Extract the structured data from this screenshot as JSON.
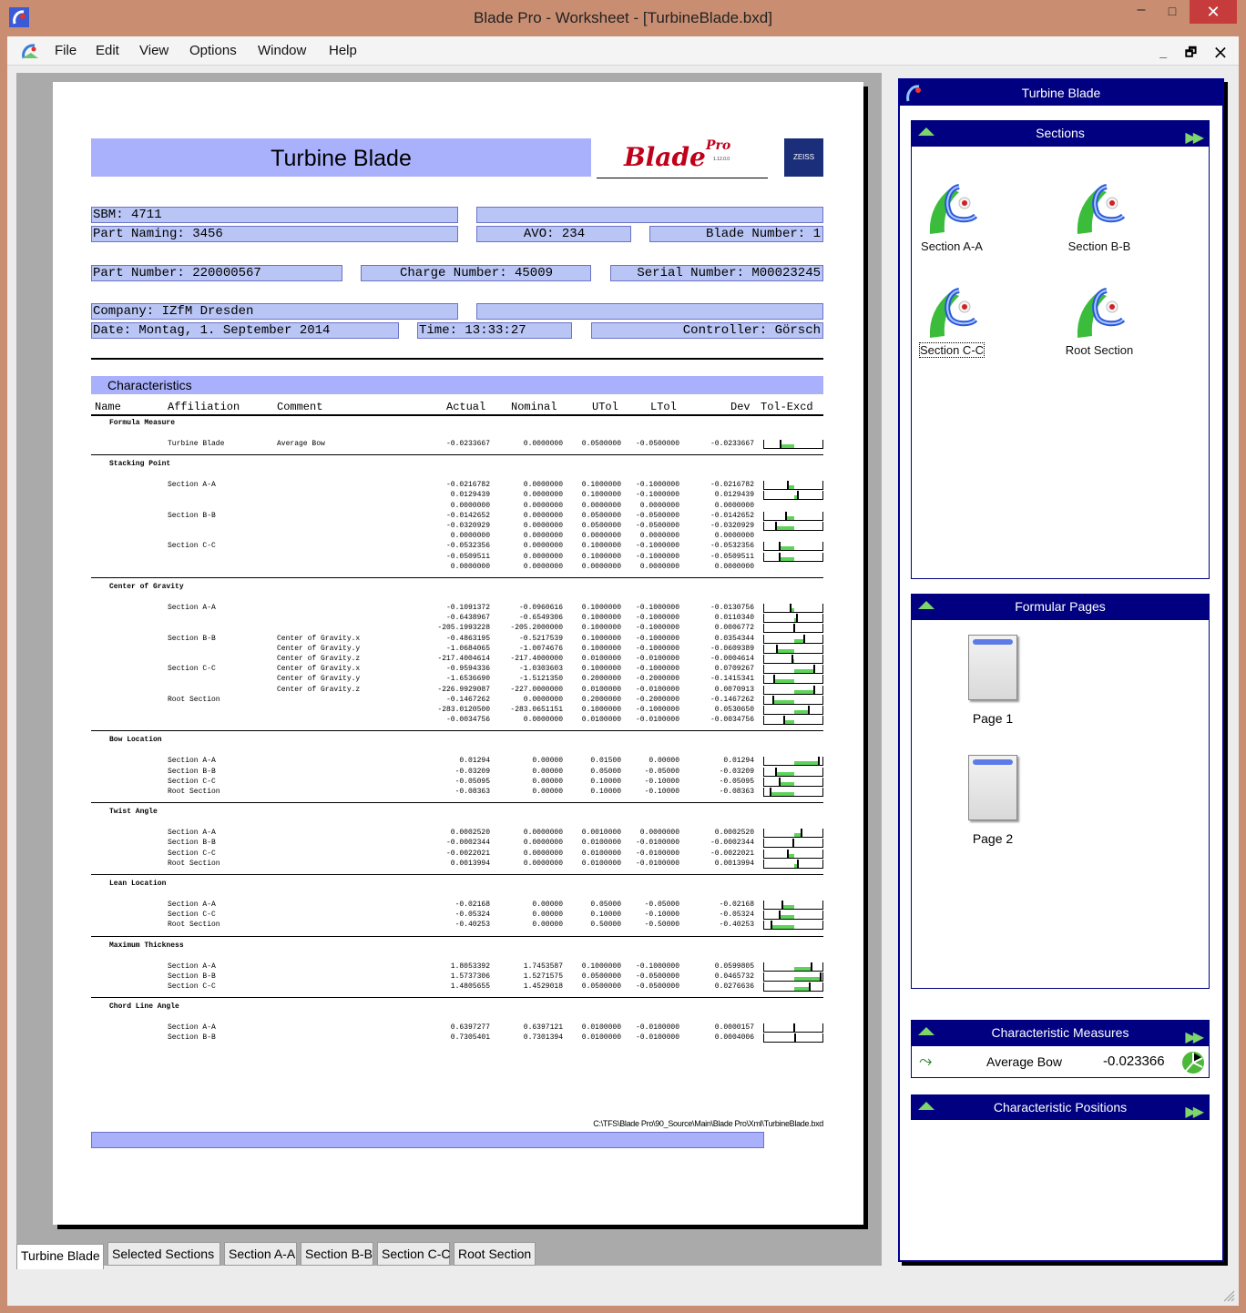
{
  "window": {
    "title": "Blade Pro - Worksheet - [TurbineBlade.bxd]",
    "min": "‒",
    "max": "□",
    "close": "✕"
  },
  "menu": [
    "File",
    "Edit",
    "View",
    "Options",
    "Window",
    "Help"
  ],
  "mdi_controls": "_ 🗗 ✕",
  "report": {
    "title": "Turbine Blade",
    "logo_text": "Blade",
    "logo_sup": "Pro",
    "logo_version": "1.12.0.0",
    "brand_mark": "ZEISS",
    "fields": {
      "sbm": "SBM: 4711",
      "part_naming": "Part Naming: 3456",
      "avo": "AVO: 234",
      "blade_number": "Blade Number: 1",
      "part_number": "Part Number: 220000567",
      "charge_number": "Charge Number: 45009",
      "serial_number": "Serial Number: M00023245",
      "company": "Company: IZfM Dresden",
      "date": "Date: Montag, 1. September 2014",
      "time": "Time: 13:33:27",
      "controller": "Controller: Görsch"
    },
    "characteristics_label": "Characteristics",
    "columns": [
      "Name",
      "Affiliation",
      "Comment",
      "Actual",
      "Nominal",
      "UTol",
      "LTol",
      "Dev",
      "Tol-Excd"
    ],
    "groups": [
      {
        "name": "Formula Measure",
        "rows": [
          {
            "aff": "Turbine Blade",
            "com": "Average Bow",
            "act": "-0.0233667",
            "nom": "0.0000000",
            "ut": "0.0500000",
            "lt": "-0.0500000",
            "dev": "-0.0233667",
            "bar": -0.47
          }
        ]
      },
      {
        "name": "Stacking Point",
        "rows": [
          {
            "aff": "Section A-A",
            "com": "",
            "act": "-0.0216782",
            "nom": "0.0000000",
            "ut": "0.1000000",
            "lt": "-0.1000000",
            "dev": "-0.0216782",
            "bar": -0.22
          },
          {
            "aff": "",
            "com": "",
            "act": "0.0129439",
            "nom": "0.0000000",
            "ut": "0.1000000",
            "lt": "-0.1000000",
            "dev": "0.0129439",
            "bar": 0.13
          },
          {
            "aff": "",
            "com": "",
            "act": "0.0000000",
            "nom": "0.0000000",
            "ut": "0.0000000",
            "lt": "0.0000000",
            "dev": "0.0000000",
            "bar": null
          },
          {
            "aff": "Section B-B",
            "com": "",
            "act": "-0.0142652",
            "nom": "0.0000000",
            "ut": "0.0500000",
            "lt": "-0.0500000",
            "dev": "-0.0142652",
            "bar": -0.29
          },
          {
            "aff": "",
            "com": "",
            "act": "-0.0320929",
            "nom": "0.0000000",
            "ut": "0.0500000",
            "lt": "-0.0500000",
            "dev": "-0.0320929",
            "bar": -0.64
          },
          {
            "aff": "",
            "com": "",
            "act": "0.0000000",
            "nom": "0.0000000",
            "ut": "0.0000000",
            "lt": "0.0000000",
            "dev": "0.0000000",
            "bar": null
          },
          {
            "aff": "Section C-C",
            "com": "",
            "act": "-0.0532356",
            "nom": "0.0000000",
            "ut": "0.1000000",
            "lt": "-0.1000000",
            "dev": "-0.0532356",
            "bar": -0.53
          },
          {
            "aff": "",
            "com": "",
            "act": "-0.0509511",
            "nom": "0.0000000",
            "ut": "0.1000000",
            "lt": "-0.1000000",
            "dev": "-0.0509511",
            "bar": -0.51
          },
          {
            "aff": "",
            "com": "",
            "act": "0.0000000",
            "nom": "0.0000000",
            "ut": "0.0000000",
            "lt": "0.0000000",
            "dev": "0.0000000",
            "bar": null
          }
        ]
      },
      {
        "name": "Center of Gravity",
        "rows": [
          {
            "aff": "Section A-A",
            "com": "",
            "act": "-0.1091372",
            "nom": "-0.0960616",
            "ut": "0.1000000",
            "lt": "-0.1000000",
            "dev": "-0.0130756",
            "bar": -0.13
          },
          {
            "aff": "",
            "com": "",
            "act": "-0.6438967",
            "nom": "-0.6549306",
            "ut": "0.1000000",
            "lt": "-0.1000000",
            "dev": "0.0110340",
            "bar": 0.11
          },
          {
            "aff": "",
            "com": "",
            "act": "-205.1993228",
            "nom": "-205.2000000",
            "ut": "0.1000000",
            "lt": "-0.1000000",
            "dev": "0.0006772",
            "bar": 0.01
          },
          {
            "aff": "Section B-B",
            "com": "Center of Gravity.x",
            "act": "-0.4863195",
            "nom": "-0.5217539",
            "ut": "0.1000000",
            "lt": "-0.1000000",
            "dev": "0.0354344",
            "bar": 0.35
          },
          {
            "aff": "",
            "com": "Center of Gravity.y",
            "act": "-1.0684065",
            "nom": "-1.0074676",
            "ut": "0.1000000",
            "lt": "-0.1000000",
            "dev": "-0.0609389",
            "bar": -0.61
          },
          {
            "aff": "",
            "com": "Center of Gravity.z",
            "act": "-217.4004614",
            "nom": "-217.4000000",
            "ut": "0.0100000",
            "lt": "-0.0100000",
            "dev": "-0.0004614",
            "bar": -0.05
          },
          {
            "aff": "Section C-C",
            "com": "Center of Gravity.x",
            "act": "-0.9594336",
            "nom": "-1.0303603",
            "ut": "0.1000000",
            "lt": "-0.1000000",
            "dev": "0.0709267",
            "bar": 0.71
          },
          {
            "aff": "",
            "com": "Center of Gravity.y",
            "act": "-1.6536690",
            "nom": "-1.5121350",
            "ut": "0.2000000",
            "lt": "-0.2000000",
            "dev": "-0.1415341",
            "bar": -0.71
          },
          {
            "aff": "",
            "com": "Center of Gravity.z",
            "act": "-226.9929087",
            "nom": "-227.0000000",
            "ut": "0.0100000",
            "lt": "-0.0100000",
            "dev": "0.0070913",
            "bar": 0.71
          },
          {
            "aff": "Root Section",
            "com": "",
            "act": "-0.1467262",
            "nom": "0.0000000",
            "ut": "0.2000000",
            "lt": "-0.2000000",
            "dev": "-0.1467262",
            "bar": -0.73
          },
          {
            "aff": "",
            "com": "",
            "act": "-283.0120500",
            "nom": "-283.0651151",
            "ut": "0.1000000",
            "lt": "-0.1000000",
            "dev": "0.0530650",
            "bar": 0.53
          },
          {
            "aff": "",
            "com": "",
            "act": "-0.0034756",
            "nom": "0.0000000",
            "ut": "0.0100000",
            "lt": "-0.0100000",
            "dev": "-0.0034756",
            "bar": -0.35
          }
        ]
      },
      {
        "name": "Bow Location",
        "rows": [
          {
            "aff": "Section A-A",
            "com": "",
            "act": "0.01294",
            "nom": "0.00000",
            "ut": "0.01500",
            "lt": "0.00000",
            "dev": "0.01294",
            "bar": 0.86
          },
          {
            "aff": "Section B-B",
            "com": "",
            "act": "-0.03209",
            "nom": "0.00000",
            "ut": "0.05000",
            "lt": "-0.05000",
            "dev": "-0.03209",
            "bar": -0.64
          },
          {
            "aff": "Section C-C",
            "com": "",
            "act": "-0.05095",
            "nom": "0.00000",
            "ut": "0.10000",
            "lt": "-0.10000",
            "dev": "-0.05095",
            "bar": -0.51
          },
          {
            "aff": "Root Section",
            "com": "",
            "act": "-0.08363",
            "nom": "0.00000",
            "ut": "0.10000",
            "lt": "-0.10000",
            "dev": "-0.08363",
            "bar": -0.84
          }
        ]
      },
      {
        "name": "Twist Angle",
        "rows": [
          {
            "aff": "Section A-A",
            "com": "",
            "act": "0.0002520",
            "nom": "0.0000000",
            "ut": "0.0010000",
            "lt": "0.0000000",
            "dev": "0.0002520",
            "bar": 0.25
          },
          {
            "aff": "Section B-B",
            "com": "",
            "act": "-0.0002344",
            "nom": "0.0000000",
            "ut": "0.0100000",
            "lt": "-0.0100000",
            "dev": "-0.0002344",
            "bar": -0.02
          },
          {
            "aff": "Section C-C",
            "com": "",
            "act": "-0.0022021",
            "nom": "0.0000000",
            "ut": "0.0100000",
            "lt": "-0.0100000",
            "dev": "-0.0022021",
            "bar": -0.22
          },
          {
            "aff": "Root Section",
            "com": "",
            "act": "0.0013994",
            "nom": "0.0000000",
            "ut": "0.0100000",
            "lt": "-0.0100000",
            "dev": "0.0013994",
            "bar": 0.14
          }
        ]
      },
      {
        "name": "Lean Location",
        "rows": [
          {
            "aff": "Section A-A",
            "com": "",
            "act": "-0.02168",
            "nom": "0.00000",
            "ut": "0.05000",
            "lt": "-0.05000",
            "dev": "-0.02168",
            "bar": -0.43
          },
          {
            "aff": "Section C-C",
            "com": "",
            "act": "-0.05324",
            "nom": "0.00000",
            "ut": "0.10000",
            "lt": "-0.10000",
            "dev": "-0.05324",
            "bar": -0.53
          },
          {
            "aff": "Root Section",
            "com": "",
            "act": "-0.40253",
            "nom": "0.00000",
            "ut": "0.50000",
            "lt": "-0.50000",
            "dev": "-0.40253",
            "bar": -0.81
          }
        ]
      },
      {
        "name": "Maximum Thickness",
        "rows": [
          {
            "aff": "Section A-A",
            "com": "",
            "act": "1.8053392",
            "nom": "1.7453587",
            "ut": "0.1000000",
            "lt": "-0.1000000",
            "dev": "0.0599805",
            "bar": 0.6
          },
          {
            "aff": "Section B-B",
            "com": "",
            "act": "1.5737306",
            "nom": "1.5271575",
            "ut": "0.0500000",
            "lt": "-0.0500000",
            "dev": "0.0465732",
            "bar": 0.93
          },
          {
            "aff": "Section C-C",
            "com": "",
            "act": "1.4805655",
            "nom": "1.4529018",
            "ut": "0.0500000",
            "lt": "-0.0500000",
            "dev": "0.0276636",
            "bar": 0.55
          }
        ]
      },
      {
        "name": "Chord Line Angle",
        "rows": [
          {
            "aff": "Section A-A",
            "com": "",
            "act": "0.6397277",
            "nom": "0.6397121",
            "ut": "0.0100000",
            "lt": "-0.0100000",
            "dev": "0.0000157",
            "bar": 0.0
          },
          {
            "aff": "Section B-B",
            "com": "",
            "act": "0.7305401",
            "nom": "0.7301394",
            "ut": "0.0100000",
            "lt": "-0.0100000",
            "dev": "0.0004006",
            "bar": 0.04
          }
        ]
      }
    ],
    "file_path": "C:\\TFS\\Blade Pro\\90_Source\\Main\\Blade Pro\\Xml\\TurbineBlade.bxd"
  },
  "tabs": [
    "Turbine Blade",
    "Selected Sections",
    "Section A-A",
    "Section B-B",
    "Section C-C",
    "Root Section"
  ],
  "side": {
    "title": "Turbine Blade",
    "sections_header": "Sections",
    "sections": [
      "Section A-A",
      "Section B-B",
      "Section C-C",
      "Root Section"
    ],
    "formular_header": "Formular Pages",
    "pages": [
      "Page 1",
      "Page 2"
    ],
    "char_measures_header": "Characteristic Measures",
    "measure": {
      "name": "Average Bow",
      "value": "-0.023366"
    },
    "char_positions_header": "Characteristic Positions"
  },
  "colors": {
    "accent": "#000080",
    "band": "#aab1fc",
    "field": "#b9c5f4",
    "ok": "#5ed35a"
  }
}
